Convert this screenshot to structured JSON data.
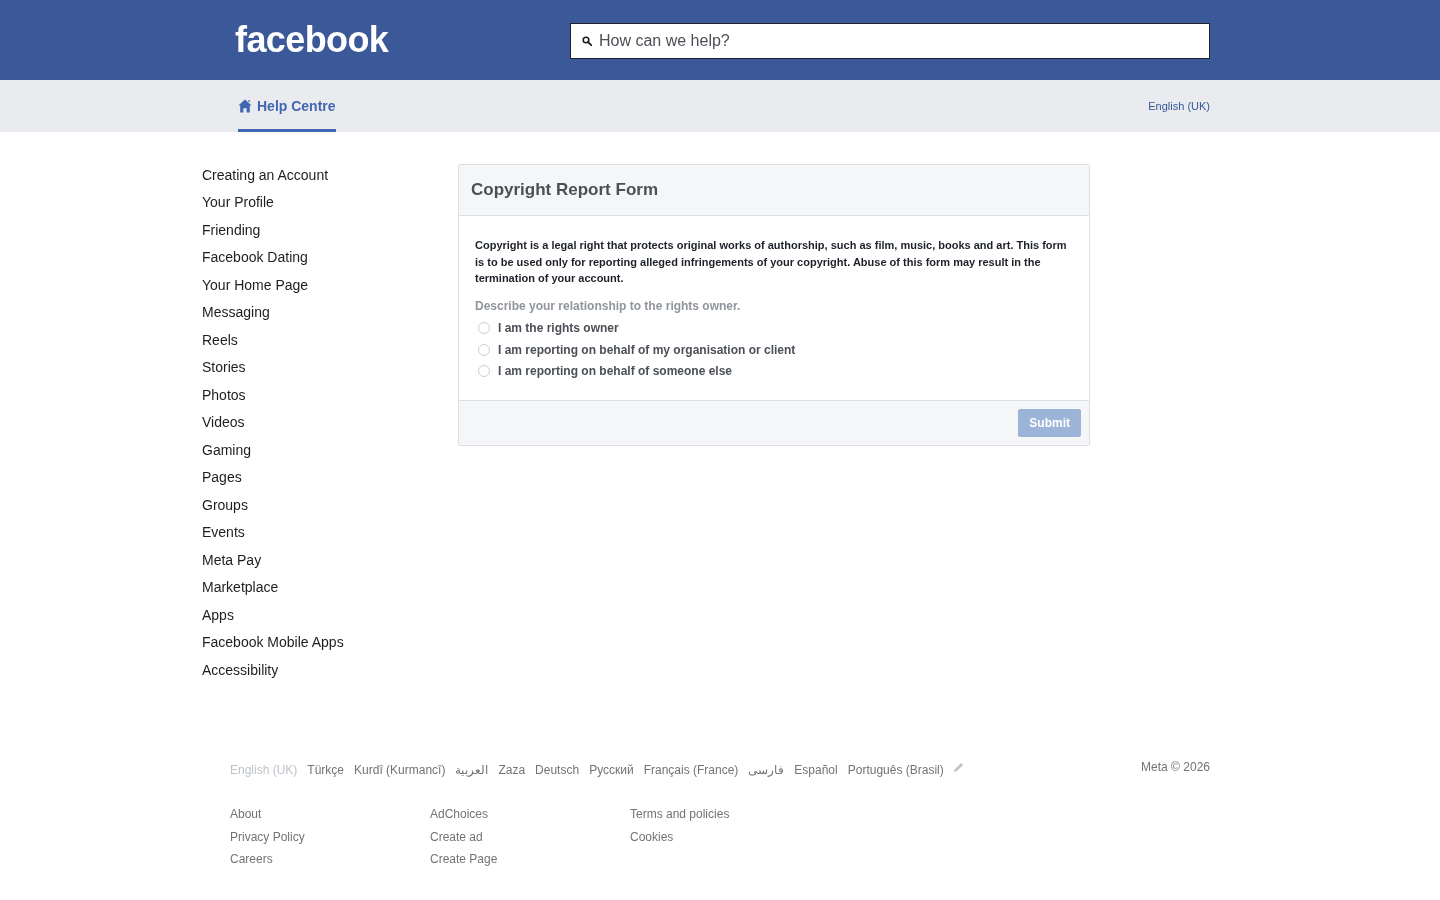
{
  "header": {
    "logo": "facebook",
    "search": {
      "placeholder": "How can we help?"
    }
  },
  "subnav": {
    "tabs": [
      {
        "label": "Help Centre",
        "selected": true
      }
    ],
    "language": "English (UK)"
  },
  "sidebar": {
    "items": [
      "Creating an Account",
      "Your Profile",
      "Friending",
      "Facebook Dating",
      "Your Home Page",
      "Messaging",
      "Reels",
      "Stories",
      "Photos",
      "Videos",
      "Gaming",
      "Pages",
      "Groups",
      "Events",
      "Meta Pay",
      "Marketplace",
      "Apps",
      "Facebook Mobile Apps",
      "Accessibility"
    ]
  },
  "form": {
    "title": "Copyright Report Form",
    "intro": "Copyright is a legal right that protects original works of authorship, such as film, music, books and art. This form is to be used only for reporting alleged infringements of your copyright. Abuse of this form may result in the termination of your account.",
    "question": "Describe your relationship to the rights owner.",
    "options": [
      {
        "label": "I am the rights owner",
        "selected": false
      },
      {
        "label": "I am reporting on behalf of my organisation or client",
        "selected": false
      },
      {
        "label": "I am reporting on behalf of someone else",
        "selected": false
      }
    ],
    "submit": {
      "label": "Submit",
      "disabled": true
    }
  },
  "footer": {
    "languages": [
      {
        "label": "English (UK)",
        "selected": true
      },
      {
        "label": "Türkçe",
        "selected": false
      },
      {
        "label": "Kurdî (Kurmancî)",
        "selected": false
      },
      {
        "label": "العربية",
        "selected": false
      },
      {
        "label": "Zaza",
        "selected": false
      },
      {
        "label": "Deutsch",
        "selected": false
      },
      {
        "label": "Русский",
        "selected": false
      },
      {
        "label": "Français (France)",
        "selected": false
      },
      {
        "label": "فارسی",
        "selected": false
      },
      {
        "label": "Español",
        "selected": false
      },
      {
        "label": "Português (Brasil)",
        "selected": false
      }
    ],
    "copyright": "Meta © 2026",
    "link_columns": [
      [
        "About",
        "Privacy Policy",
        "Careers"
      ],
      [
        "AdChoices",
        "Create ad",
        "Create Page"
      ],
      [
        "Terms and policies",
        "Cookies"
      ]
    ]
  }
}
